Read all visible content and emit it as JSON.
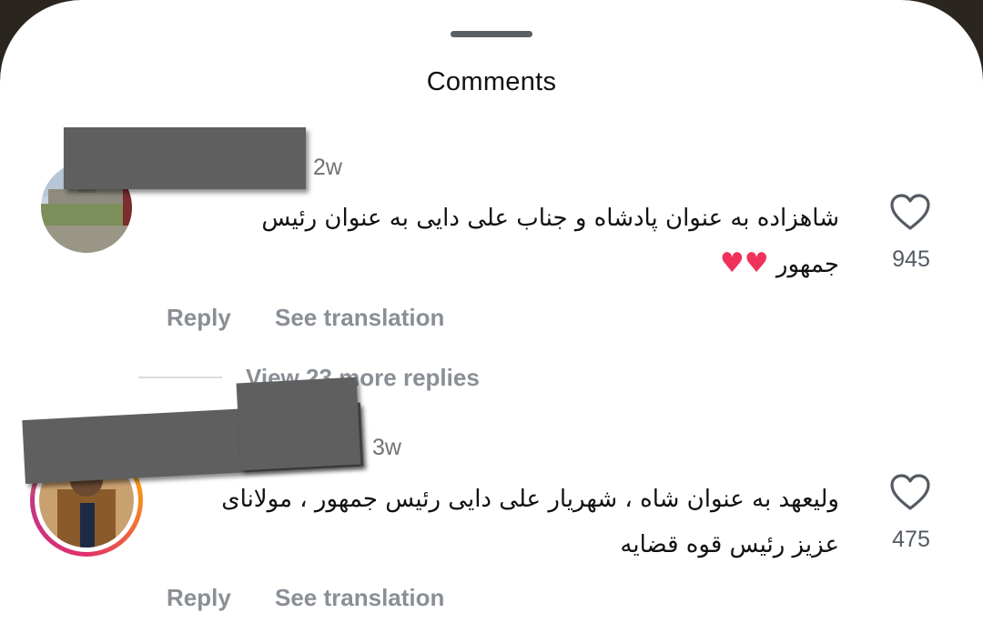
{
  "sheet": {
    "title": "Comments"
  },
  "comments": [
    {
      "username": "",
      "timestamp": "2w",
      "text_line1": "شاهزاده به عنوان پادشاه و جناب علی دایی به عنوان رئیس",
      "text_line2": "جمهور",
      "hearts": "♥♥",
      "like_count": "945",
      "reply_label": "Reply",
      "translate_label": "See translation",
      "view_replies_label": "View 23 more replies"
    },
    {
      "username": "",
      "timestamp": "3w",
      "text_line1": "ولیعهد به عنوان شاه ، شهریار علی دایی رئیس جمهور ، مولانای",
      "text_line2": "عزیز رئیس قوه قضایه",
      "like_count": "475",
      "reply_label": "Reply",
      "translate_label": "See translation"
    }
  ],
  "icons": {
    "like": "heart-outline-icon"
  },
  "colors": {
    "heart": "#f0325a",
    "story_ring": [
      "#f9c400",
      "#f7891f",
      "#e1306c",
      "#c13584"
    ]
  }
}
